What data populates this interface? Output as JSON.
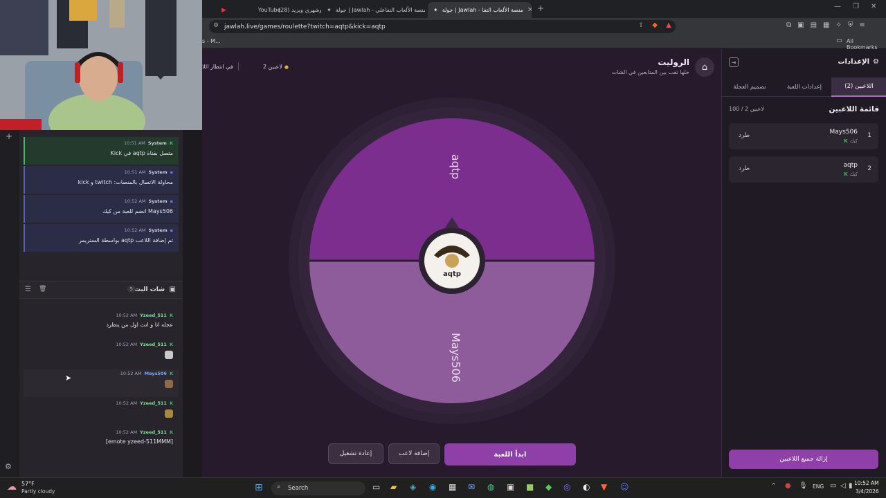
{
  "browser": {
    "tabs": [
      {
        "title": "YouTube",
        "active": false
      },
      {
        "title": "(28) بوشهري ويزيد",
        "active": false
      },
      {
        "title": "جولة | Jawlah - منصة الألعاب التفاعلي",
        "active": false
      },
      {
        "title": "جولة | Jawlah - منصة الألعاب التفا",
        "active": true
      }
    ],
    "new_tab": "+",
    "url": "jawlah.live/games/roulette?twitch=aqtp&kick=aqtp",
    "bookmarks_left": "s - M...",
    "all_bookmarks": "All Bookmarks"
  },
  "stream_panel": {
    "system_messages": [
      {
        "time": "10:51 AM",
        "who": "System",
        "text": "متصل بقناة aqtp في Kick",
        "platform": "kick"
      },
      {
        "time": "10:51 AM",
        "who": "System",
        "text": "محاولة الاتصال بالمنصات: twitch و kick",
        "platform": "system"
      },
      {
        "time": "10:52 AM",
        "who": "System",
        "text": "Mays506 انضم للعبة من كيك",
        "platform": "system"
      },
      {
        "time": "10:52 AM",
        "who": "System",
        "text": "تم إضافة اللاعب aqtp بواسطة الستريمر",
        "platform": "system"
      }
    ],
    "chat_header": "شات البث",
    "chat_count": "5",
    "chat_messages": [
      {
        "time": "10:52 AM",
        "who": "Yzeed_511",
        "text": "عجله انا و انت اول من ينطرد",
        "color": "#7ee09a"
      },
      {
        "time": "10:52 AM",
        "who": "Yzeed_511",
        "text": "",
        "color": "#7ee09a"
      },
      {
        "time": "10:52 AM",
        "who": "Mays506",
        "text": "",
        "color": "#7aa6ff"
      },
      {
        "time": "10:52 AM",
        "who": "Yzeed_511",
        "text": "",
        "color": "#7ee09a"
      },
      {
        "time": "10:52 AM",
        "who": "Yzeed_511",
        "text": "[emote yzeed-511MMM]",
        "color": "#7ee09a"
      }
    ]
  },
  "game": {
    "title": "الروليت",
    "subtitle": "خلها تقب بين المتابعين في الشات",
    "players_badge": "2 لاعبين",
    "status": "في انتظار اللا",
    "wheel": {
      "top_segment": "aqtp",
      "bottom_segment": "Mays506",
      "center_logo": "aqtp",
      "top_color": "#7c2e8e",
      "bottom_color": "#8f5c9b"
    },
    "buttons": {
      "start": "ابدأ اللعبة",
      "add_player": "إضافة لاعب",
      "restart": "إعادة تشغيل"
    }
  },
  "settings": {
    "title": "الإعدادات",
    "tabs": [
      "اللاعبين (2)",
      "إعدادات اللعبة",
      "تصميم العجلة"
    ],
    "players_list_title": "قائمة اللاعبين",
    "players_count": "100 / 2 لاعبين",
    "players": [
      {
        "index": "1",
        "name": "Mays506",
        "platform": "كيك",
        "kick_label": "طرد"
      },
      {
        "index": "2",
        "name": "aqtp",
        "platform": "كيك",
        "kick_label": "طرد"
      }
    ],
    "remove_all": "إزالة جميع اللاعبين"
  },
  "taskbar": {
    "weather_temp": "57°F",
    "weather_desc": "Partly cloudy",
    "search": "Search",
    "lang": "ENG",
    "time": "10:52 AM",
    "date": "3/4/2026"
  },
  "colors": {
    "accent": "#8e3fa8",
    "kick_green": "#3fb868"
  }
}
